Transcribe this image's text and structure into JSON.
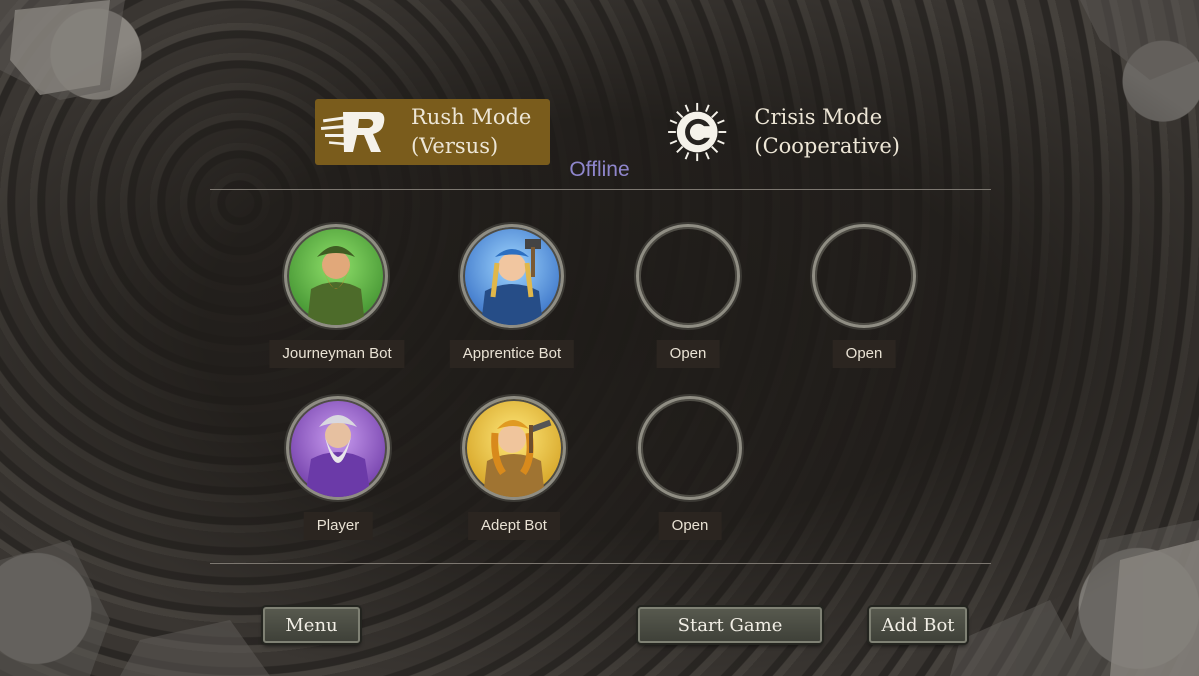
{
  "modes": [
    {
      "label_line1": "Rush Mode",
      "label_line2": "(Versus)",
      "selected": true,
      "icon": "rush-mode-icon"
    },
    {
      "label_line1": "Crisis Mode",
      "label_line2": "(Cooperative)",
      "selected": false,
      "icon": "crisis-mode-icon"
    }
  ],
  "status": "Offline",
  "slots": [
    {
      "name": "Journeyman Bot",
      "portrait": "green-bearded-dwarf",
      "color": "#4ea23a"
    },
    {
      "name": "Apprentice Bot",
      "portrait": "blue-dwarf-with-hammer",
      "color": "#2f6fc4"
    },
    {
      "name": "Open",
      "portrait": null
    },
    {
      "name": "Open",
      "portrait": null
    },
    {
      "name": "Player",
      "portrait": "purple-wizard-dwarf",
      "color": "#7a3ab0"
    },
    {
      "name": "Adept Bot",
      "portrait": "yellow-dwarf-with-pickaxe",
      "color": "#d6a21c"
    },
    {
      "name": "Open",
      "portrait": null
    }
  ],
  "buttons": {
    "menu": "Menu",
    "start_game": "Start Game",
    "add_bot": "Add Bot"
  }
}
